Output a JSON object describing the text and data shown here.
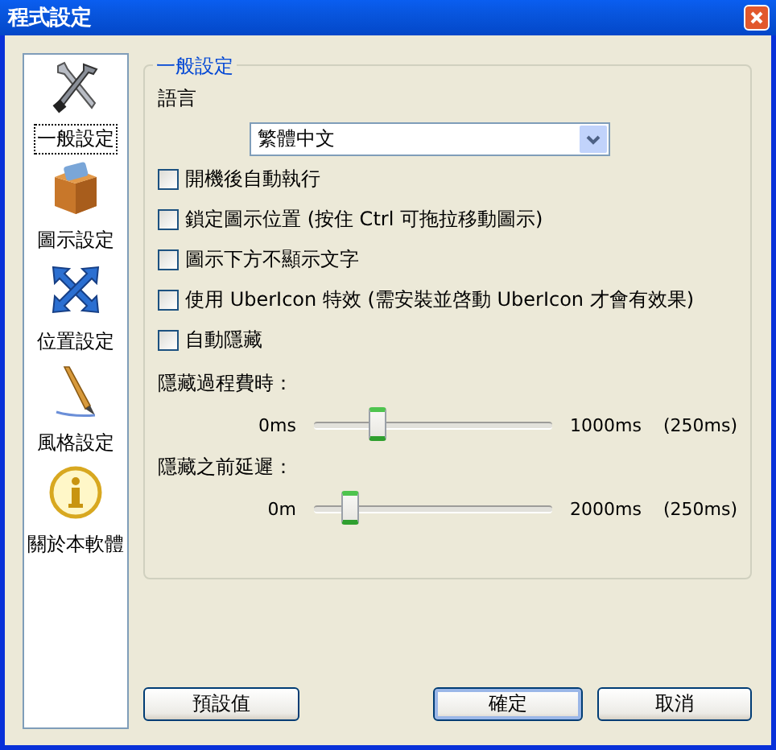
{
  "window": {
    "title": "程式設定"
  },
  "sidebar": {
    "items": [
      {
        "label": "一般設定",
        "selected": true
      },
      {
        "label": "圖示設定",
        "selected": false
      },
      {
        "label": "位置設定",
        "selected": false
      },
      {
        "label": "風格設定",
        "selected": false
      },
      {
        "label": "關於本軟體",
        "selected": false
      }
    ]
  },
  "general": {
    "group_title": "一般設定",
    "language": {
      "label": "語言",
      "value": "繁體中文"
    },
    "options": [
      {
        "label": "開機後自動執行",
        "checked": false
      },
      {
        "label": "鎖定圖示位置 (按住 Ctrl 可拖拉移動圖示)",
        "checked": false
      },
      {
        "label": "圖示下方不顯示文字",
        "checked": false
      },
      {
        "label": "使用 UberIcon 特效 (需安裝並啓動 UberIcon 才會有效果)",
        "checked": false
      },
      {
        "label": "自動隱藏",
        "checked": false
      }
    ],
    "sliders": [
      {
        "label": "隱藏過程費時：",
        "min": "0ms",
        "max": "1000ms",
        "reading": "(250ms)",
        "level": 0.25
      },
      {
        "label": "隱藏之前延遲：",
        "min": "0m",
        "max": "2000ms",
        "reading": "(250ms)",
        "level": 0.125
      }
    ]
  },
  "buttons": [
    {
      "label": "預設值",
      "default": false
    },
    {
      "label": "確定",
      "default": true
    },
    {
      "label": "取消",
      "default": false
    }
  ]
}
